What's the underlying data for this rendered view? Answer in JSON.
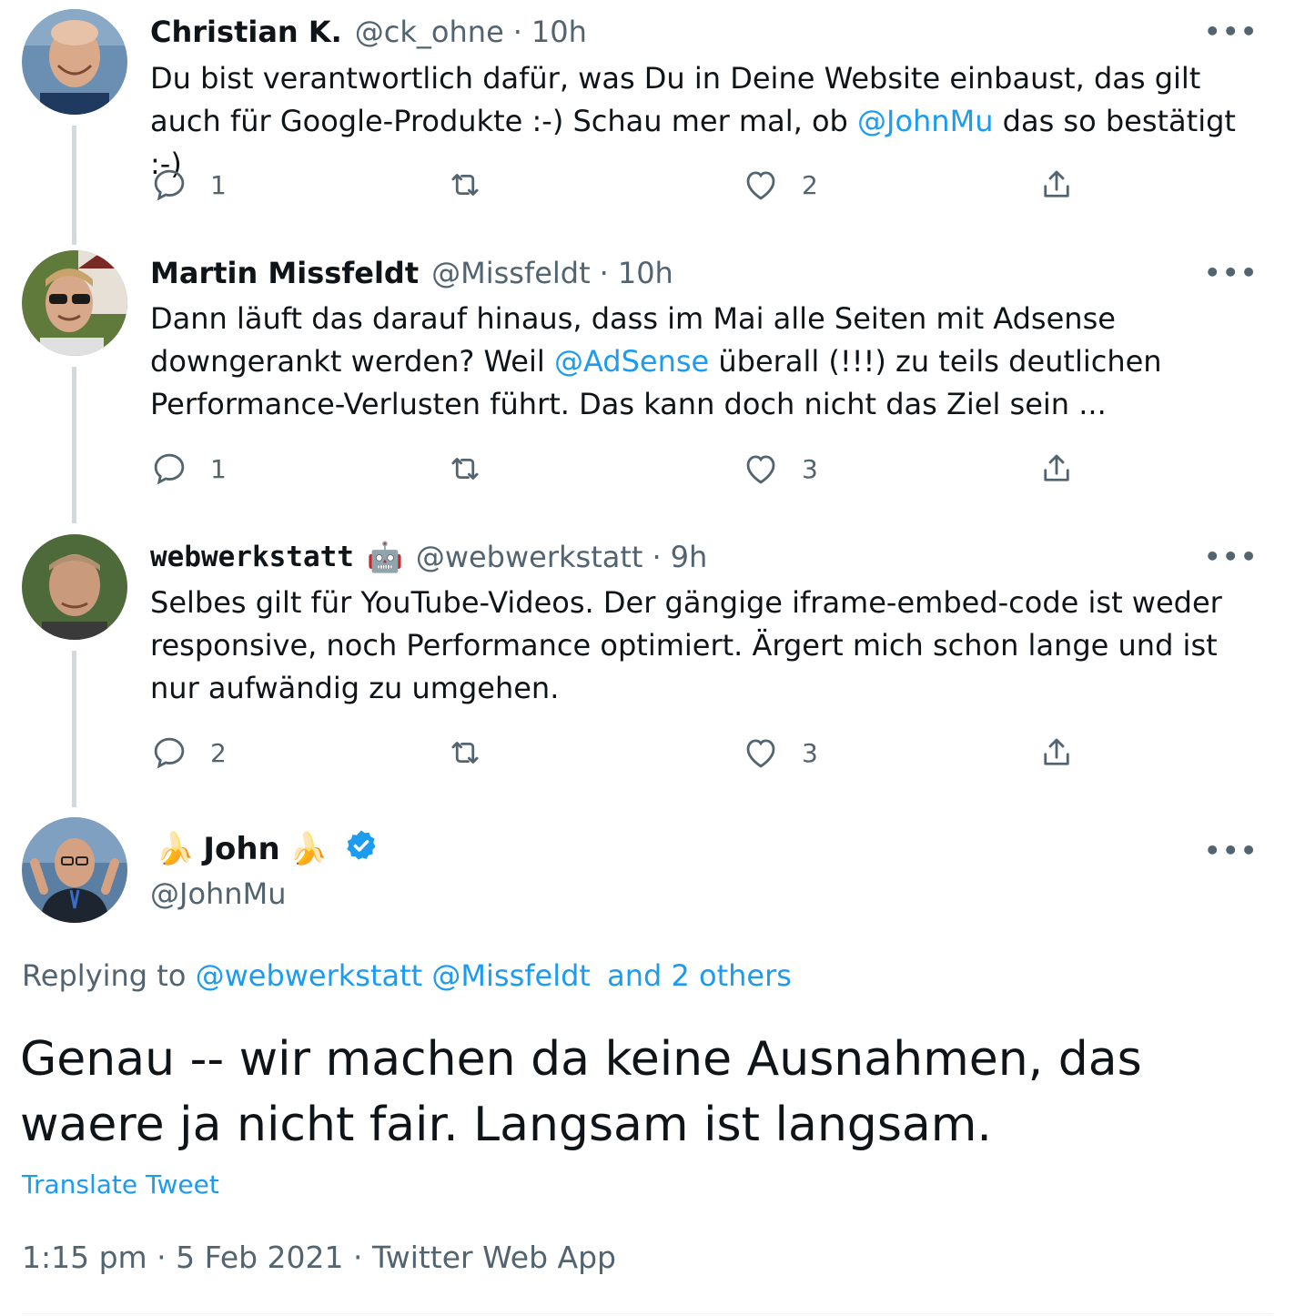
{
  "thread": [
    {
      "name": "Christian K.",
      "handle": "@ck_ohne",
      "separator": "·",
      "time": "10h",
      "text_before": "Du bist verantwortlich dafür, was Du in Deine Website einbaust, das gilt auch für Google-Produkte :-) Schau mer mal, ob ",
      "mention": "@JohnMu",
      "text_after": " das so bestätigt :-)",
      "replies": "1",
      "retweets": "",
      "likes": "2",
      "more": "•••"
    },
    {
      "name": "Martin Missfeldt",
      "handle": "@Missfeldt",
      "separator": "·",
      "time": "10h",
      "text_before": "Dann läuft das darauf hinaus, dass im Mai alle Seiten mit Adsense downgerankt werden? Weil ",
      "mention": "@AdSense",
      "text_after": " überall (!!!) zu teils deutlichen Performance-Verlusten führt. Das kann doch nicht das Ziel sein ...",
      "replies": "1",
      "retweets": "",
      "likes": "3",
      "more": "•••"
    },
    {
      "name": "webwerkstatt",
      "name_emoji": "🤖",
      "handle": "@webwerkstatt",
      "separator": "·",
      "time": "9h",
      "text_before": "Selbes gilt für YouTube-Videos. Der gängige iframe-embed-code ist weder responsive, noch Performance optimiert. Ärgert mich schon lange und ist nur aufwändig zu umgehen.",
      "mention": "",
      "text_after": "",
      "replies": "2",
      "retweets": "",
      "likes": "3",
      "more": "•••"
    }
  ],
  "main": {
    "name_prefix_emoji": "🍌",
    "name": "John",
    "name_suffix_emoji": "🍌",
    "handle": "@JohnMu",
    "more": "•••",
    "replying_label": "Replying to",
    "replying_mention_1": "@webwerkstatt",
    "replying_mention_2": "@Missfeldt",
    "replying_others": "and 2 others",
    "text": "Genau -- wir machen da keine Ausnahmen, das waere ja nicht fair. Langsam ist langsam.",
    "translate": "Translate Tweet",
    "meta": "1:15 pm · 5 Feb 2021 · Twitter Web App"
  },
  "icons": {
    "reply": "reply-icon",
    "retweet": "retweet-icon",
    "like": "heart-icon",
    "share": "share-icon",
    "verified": "verified-badge-icon"
  },
  "colors": {
    "accent": "#1d9bf0",
    "secondary_text": "#536471",
    "primary_text": "#0f1419",
    "thread_line": "#cfd9de"
  }
}
